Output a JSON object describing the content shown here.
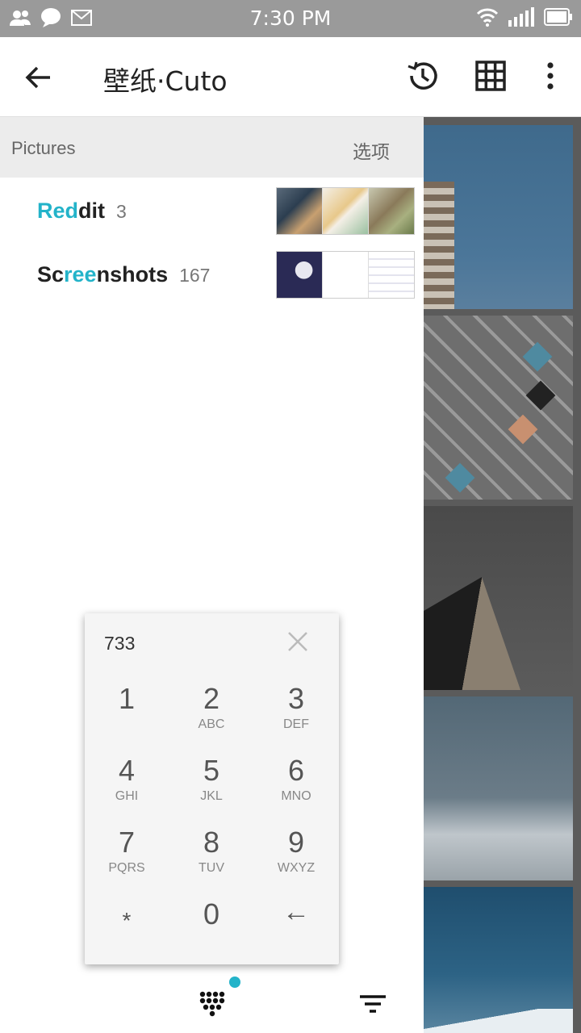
{
  "status_bar": {
    "time": "7:30 PM"
  },
  "app_bar": {
    "title": "壁纸·Cuto"
  },
  "drawer": {
    "header": "Pictures",
    "options_label": "选项",
    "albums": [
      {
        "prefix": "",
        "highlight": "Red",
        "rest": "dit",
        "count": "3"
      },
      {
        "prefix": "Sc",
        "highlight": "ree",
        "rest": "nshots",
        "count": "167"
      }
    ]
  },
  "dialpad": {
    "query": "733",
    "keys": [
      {
        "digit": "1",
        "letters": ""
      },
      {
        "digit": "2",
        "letters": "ABC"
      },
      {
        "digit": "3",
        "letters": "DEF"
      },
      {
        "digit": "4",
        "letters": "GHI"
      },
      {
        "digit": "5",
        "letters": "JKL"
      },
      {
        "digit": "6",
        "letters": "MNO"
      },
      {
        "digit": "7",
        "letters": "PQRS"
      },
      {
        "digit": "8",
        "letters": "TUV"
      },
      {
        "digit": "9",
        "letters": "WXYZ"
      },
      {
        "digit": "*",
        "letters": ""
      },
      {
        "digit": "0",
        "letters": ""
      },
      {
        "digit": "←",
        "letters": ""
      }
    ]
  },
  "colors": {
    "accent": "#23b3c9",
    "status_bar": "#9a9a9a",
    "drawer_header": "#ececec"
  }
}
